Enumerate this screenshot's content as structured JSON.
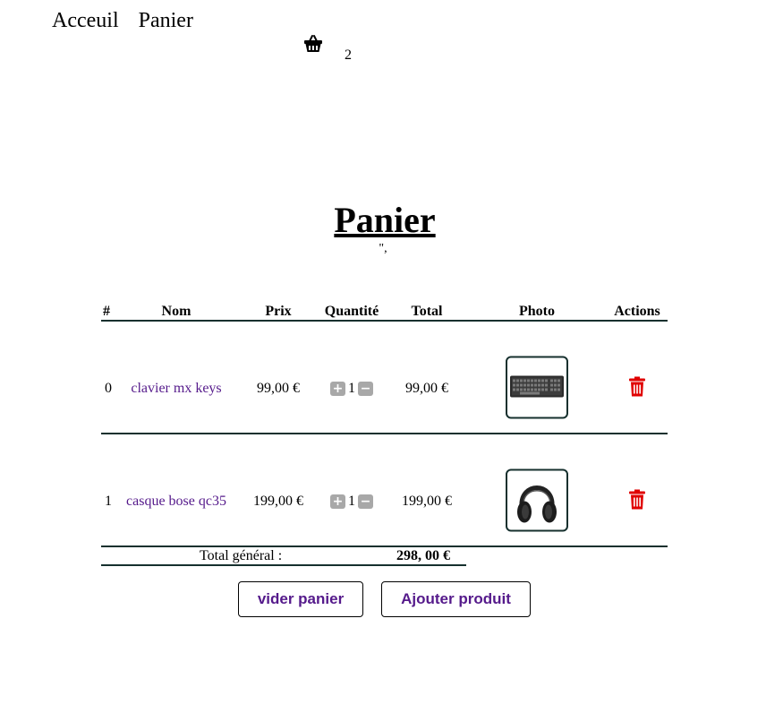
{
  "nav": {
    "home": "Acceuil",
    "cart": "Panier"
  },
  "cart_badge": {
    "icon": "basket-icon",
    "count": "2"
  },
  "page": {
    "title": "Panier",
    "stray_text": "\","
  },
  "table": {
    "headers": [
      "#",
      "Nom",
      "Prix",
      "Quantité",
      "Total",
      "Photo",
      "Actions"
    ],
    "rows": [
      {
        "index": "0",
        "name": "clavier mx keys",
        "price": "99,00  €",
        "qty": "1",
        "total": "99,00  €",
        "photo": "keyboard-photo"
      },
      {
        "index": "1",
        "name": "casque bose qc35",
        "price": "199,00  €",
        "qty": "1",
        "total": "199,00  €",
        "photo": "headphones-photo"
      }
    ],
    "grand_total_label": "Total général :",
    "grand_total_value": "298, 00  €"
  },
  "buttons": {
    "empty": "vider panier",
    "add": "Ajouter produit"
  },
  "colors": {
    "link": "#551a8b",
    "trash": "#e00000",
    "rule": "#16302e"
  }
}
